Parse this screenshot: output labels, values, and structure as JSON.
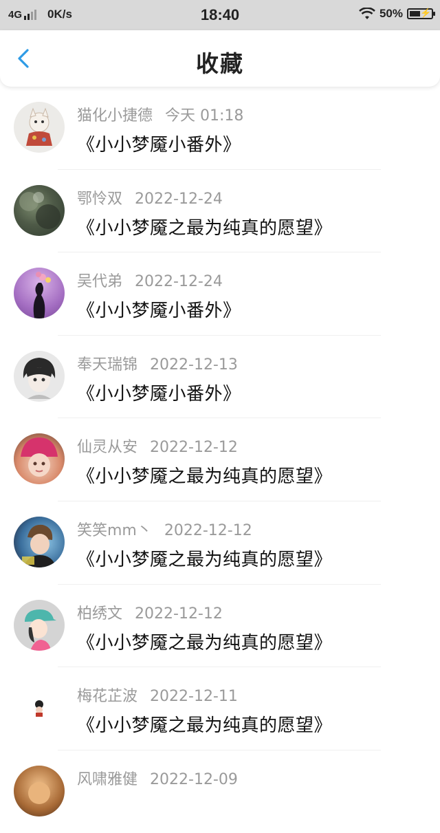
{
  "status_bar": {
    "network": "4G",
    "speed": "0K/s",
    "time": "18:40",
    "battery": "50%"
  },
  "header": {
    "title": "收藏",
    "back_icon": "chevron-left-icon",
    "accent": "#2e9be6"
  },
  "favorites": [
    {
      "user": "猫化小捷德",
      "date": "今天 01:18",
      "work": "《小小梦魇小番外》"
    },
    {
      "user": "鄂怜双",
      "date": "2022-12-24",
      "work": "《小小梦魇之最为纯真的愿望》"
    },
    {
      "user": "吴代弟",
      "date": "2022-12-24",
      "work": "《小小梦魇小番外》"
    },
    {
      "user": "奉天瑞锦",
      "date": "2022-12-13",
      "work": "《小小梦魇小番外》"
    },
    {
      "user": "仙灵从安",
      "date": "2022-12-12",
      "work": "《小小梦魇之最为纯真的愿望》"
    },
    {
      "user": "笑笑mm丶",
      "date": "2022-12-12",
      "work": "《小小梦魇之最为纯真的愿望》"
    },
    {
      "user": "柏绣文",
      "date": "2022-12-12",
      "work": "《小小梦魇之最为纯真的愿望》"
    },
    {
      "user": "梅花芷波",
      "date": "2022-12-11",
      "work": "《小小梦魇之最为纯真的愿望》"
    },
    {
      "user": "风啸雅健",
      "date": "2022-12-09",
      "work": ""
    }
  ]
}
